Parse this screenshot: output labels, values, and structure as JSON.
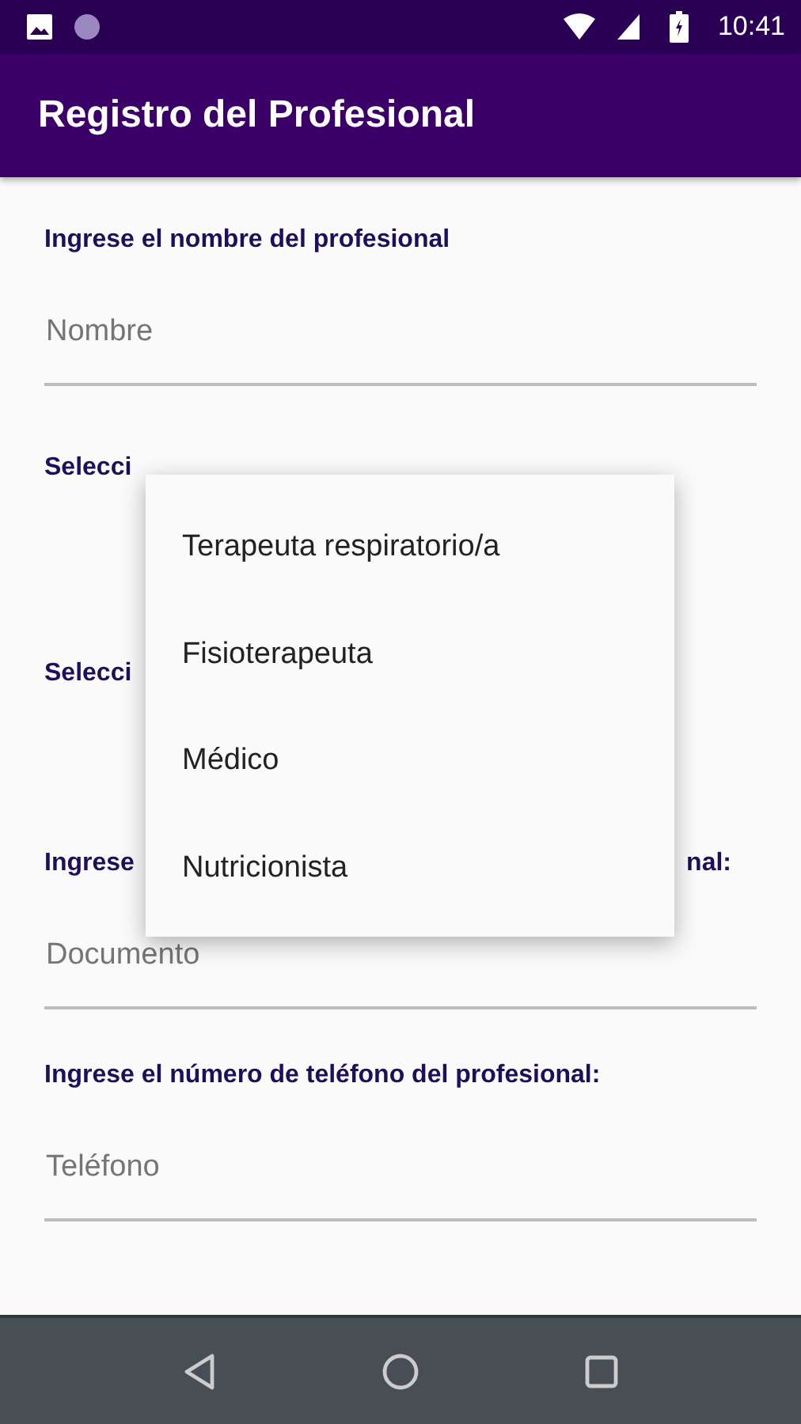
{
  "status_bar": {
    "time": "10:41"
  },
  "app_bar": {
    "title": "Registro del Profesional"
  },
  "form": [
    {
      "kind": "text",
      "label": "Ingrese el nombre del profesional",
      "placeholder": "Nombre"
    },
    {
      "kind": "spinner",
      "label": "Selecci"
    },
    {
      "kind": "spinner",
      "label": "Selecci"
    },
    {
      "kind": "text",
      "label": "Ingrese",
      "label_end": "nal:",
      "placeholder": "Documento"
    },
    {
      "kind": "text",
      "label": "Ingrese el número de teléfono del profesional:",
      "placeholder": "Teléfono"
    }
  ],
  "dropdown_menu": {
    "items": [
      "Terapeuta respiratorio/a",
      "Fisioterapeuta",
      "Médico",
      "Nutricionista"
    ]
  }
}
